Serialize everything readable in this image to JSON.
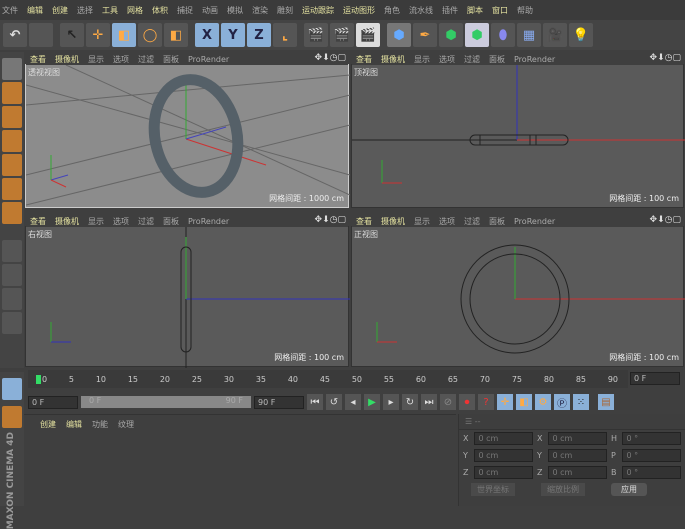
{
  "menubar": [
    "文件",
    "编辑",
    "创建",
    "选择",
    "工具",
    "网格",
    "体积",
    "捕捉",
    "动画",
    "模拟",
    "渲染",
    "雕刻",
    "运动跟踪",
    "运动图形",
    "角色",
    "流水线",
    "插件",
    "脚本",
    "窗口",
    "帮助"
  ],
  "menubar_highlight": [
    1,
    2,
    4,
    5,
    6,
    12,
    13,
    17,
    18
  ],
  "toolbar": {
    "axis_x": "X",
    "axis_y": "Y",
    "axis_z": "Z"
  },
  "viewport_menu": [
    "查看",
    "摄像机",
    "显示",
    "选项",
    "过滤",
    "面板",
    "ProRender"
  ],
  "viewport_icons": "✥⬇◷▢",
  "viewports": [
    {
      "label": "透视视图",
      "grid": "网格间距 : 1000 cm"
    },
    {
      "label": "顶视图",
      "grid": "网格间距 : 100 cm"
    },
    {
      "label": "右视图",
      "grid": "网格间距 : 100 cm"
    },
    {
      "label": "正视图",
      "grid": "网格间距 : 100 cm"
    }
  ],
  "timeline": {
    "ticks": [
      "0",
      "5",
      "10",
      "15",
      "20",
      "25",
      "30",
      "35",
      "40",
      "45",
      "50",
      "55",
      "60",
      "65",
      "70",
      "75",
      "80",
      "85",
      "90"
    ],
    "current_frame": "0 F"
  },
  "transport": {
    "start": "0 F",
    "range_start": "0 F",
    "range_end": "90 F",
    "end": "90 F"
  },
  "material_menu": [
    "创建",
    "编辑",
    "功能",
    "纹理"
  ],
  "attributes": {
    "rows": [
      [
        "X",
        "0 cm",
        "X",
        "0 cm",
        "H",
        "0 °"
      ],
      [
        "Y",
        "0 cm",
        "Y",
        "0 cm",
        "P",
        "0 °"
      ],
      [
        "Z",
        "0 cm",
        "Z",
        "0 cm",
        "B",
        "0 °"
      ]
    ],
    "coord_mode": "世界坐标",
    "scale_mode": "缩放比例",
    "apply": "应用"
  },
  "brand": "MAXON CINEMA 4D"
}
